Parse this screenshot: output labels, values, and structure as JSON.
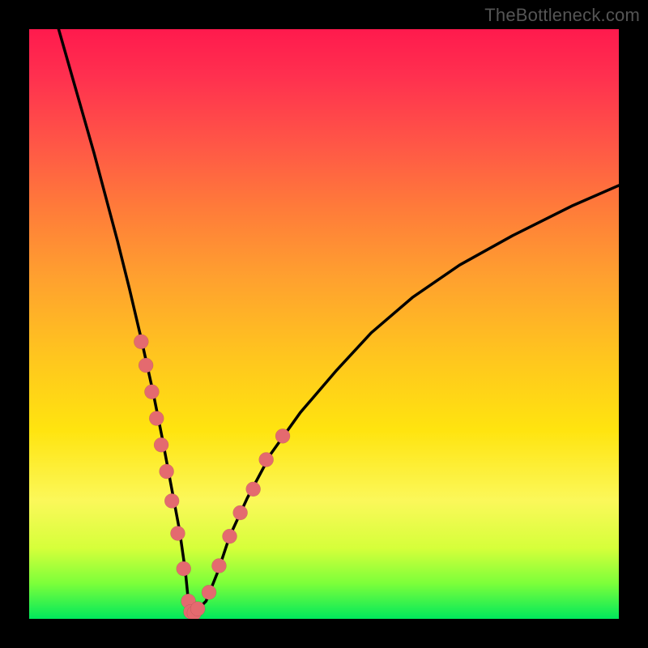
{
  "watermark": "TheBottleneck.com",
  "chart_data": {
    "type": "line",
    "title": "",
    "xlabel": "",
    "ylabel": "",
    "xlim": [
      0,
      100
    ],
    "ylim": [
      0,
      100
    ],
    "series": [
      {
        "name": "bottleneck-curve",
        "x": [
          5,
          7,
          9,
          11,
          13,
          15,
          17,
          19,
          21,
          22.5,
          24,
          25.5,
          26.5,
          27,
          27.5,
          28.5,
          30,
          32,
          34,
          37,
          41,
          46,
          52,
          58,
          65,
          73,
          82,
          92,
          100
        ],
        "values": [
          100,
          93,
          86,
          79,
          71.5,
          64,
          56,
          47.5,
          38.5,
          31,
          23,
          15,
          8,
          3,
          1,
          1.5,
          3,
          8,
          14,
          20.5,
          28,
          35,
          42,
          48.5,
          54.5,
          60,
          65,
          70,
          73.5
        ]
      },
      {
        "name": "left-cluster-markers",
        "x": [
          19.0,
          19.8,
          20.8,
          21.6,
          22.4,
          23.3,
          24.2,
          25.2,
          26.2,
          27.0
        ],
        "values": [
          47.0,
          43.0,
          38.5,
          34.0,
          29.5,
          25.0,
          20.0,
          14.5,
          8.5,
          3.0
        ]
      },
      {
        "name": "bottom-cluster-markers",
        "x": [
          27.4,
          28.0,
          28.6
        ],
        "values": [
          1.2,
          1.0,
          1.7
        ]
      },
      {
        "name": "right-cluster-markers",
        "x": [
          30.5,
          32.2,
          34.0,
          35.8,
          38.0,
          40.2,
          43.0
        ],
        "values": [
          4.5,
          9.0,
          14.0,
          18.0,
          22.0,
          27.0,
          31.0
        ]
      }
    ]
  },
  "colors": {
    "marker": "#E46A6F",
    "curve": "#000000"
  }
}
